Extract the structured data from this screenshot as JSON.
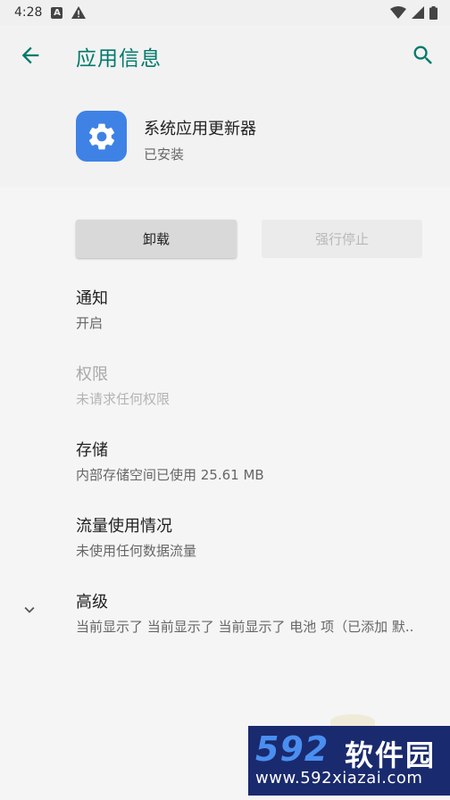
{
  "status_bar": {
    "time": "4:28",
    "notif_a": "A"
  },
  "app_bar": {
    "title": "应用信息"
  },
  "app": {
    "name": "系统应用更新器",
    "status": "已安装"
  },
  "actions": {
    "uninstall": "卸载",
    "force_stop": "强行停止"
  },
  "prefs": [
    {
      "title": "通知",
      "summary": "开启",
      "enabled": true
    },
    {
      "title": "权限",
      "summary": "未请求任何权限",
      "enabled": false
    },
    {
      "title": "存储",
      "summary": "内部存储空间已使用 25.61 MB",
      "enabled": true
    },
    {
      "title": "流量使用情况",
      "summary": "未使用任何数据流量",
      "enabled": true
    },
    {
      "title": "高级",
      "summary": "当前显示了 当前显示了 当前显示了 电池 项（已添加 默..",
      "enabled": true
    }
  ],
  "watermark": {
    "brand_num": "592",
    "brand_cn": "软件园",
    "url": "www.592xiazai.com"
  },
  "colors": {
    "accent": "#00796b",
    "icon_bg": "#3f82e6"
  }
}
